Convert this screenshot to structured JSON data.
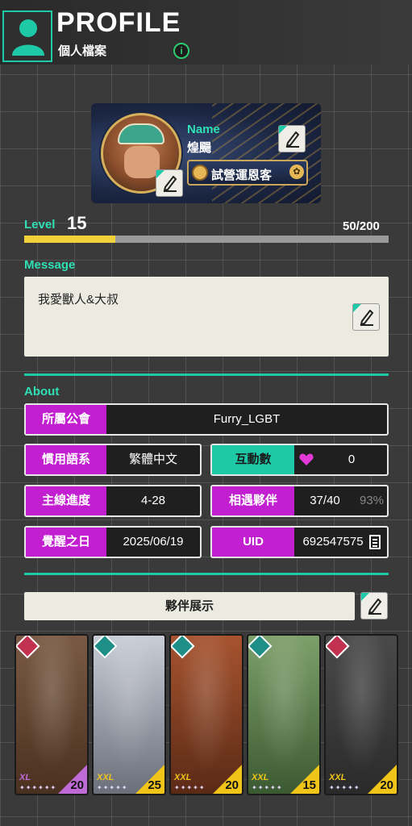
{
  "header": {
    "title": "PROFILE",
    "subtitle": "個人檔案",
    "info_glyph": "i"
  },
  "profile": {
    "name_label": "Name",
    "name": "煌颺",
    "title_badge": "試營運恩客",
    "title_badge_paw": "✿"
  },
  "level": {
    "label": "Level",
    "value": "15",
    "progress_text": "50/200",
    "progress_fraction": 0.25
  },
  "message": {
    "label": "Message",
    "text": "我愛獸人&大叔"
  },
  "about": {
    "label": "About",
    "guild_key": "所屬公會",
    "guild_value": "Furry_LGBT",
    "language_key": "慣用語系",
    "language_value": "繁體中文",
    "interactions_key": "互動數",
    "interactions_value": "0",
    "story_key": "主線進度",
    "story_value": "4-28",
    "partners_key": "相遇夥伴",
    "partners_value": "37/40",
    "partners_percent": "93%",
    "awaken_key": "覺醒之日",
    "awaken_value": "2025/06/19",
    "uid_key": "UID",
    "uid_value": "692547575"
  },
  "partner_showcase": {
    "label": "夥伴展示",
    "cards": [
      {
        "size_tag": "XL",
        "level": "20",
        "stars": "✦✦✦✦✦✦",
        "frame_color": "#c06ad8",
        "rank_color": "#c2314f",
        "art_top": "#7a5a44",
        "art_bottom": "#4a3020"
      },
      {
        "size_tag": "XXL",
        "level": "25",
        "stars": "✦✦✦✦✦",
        "frame_color": "#f0c419",
        "rank_color": "#1e8f86",
        "art_top": "#c9cdd6",
        "art_bottom": "#6b6f7a"
      },
      {
        "size_tag": "XXL",
        "level": "20",
        "stars": "✦✦✦✦✦",
        "frame_color": "#f0c419",
        "rank_color": "#1e8f86",
        "art_top": "#a7532f",
        "art_bottom": "#5a2a16"
      },
      {
        "size_tag": "XXL",
        "level": "15",
        "stars": "✦✦✦✦✦",
        "frame_color": "#f0c419",
        "rank_color": "#1e8f86",
        "art_top": "#7da06a",
        "art_bottom": "#3c5a32"
      },
      {
        "size_tag": "XXL",
        "level": "20",
        "stars": "✦✦✦✦✦",
        "frame_color": "#f0c419",
        "rank_color": "#c2314f",
        "art_top": "#4a4a4a",
        "art_bottom": "#2a2a2a"
      }
    ]
  },
  "colors": {
    "accent": "#1ec9a8",
    "key_purple": "#c21fd1",
    "level_fill": "#f2d23a"
  }
}
